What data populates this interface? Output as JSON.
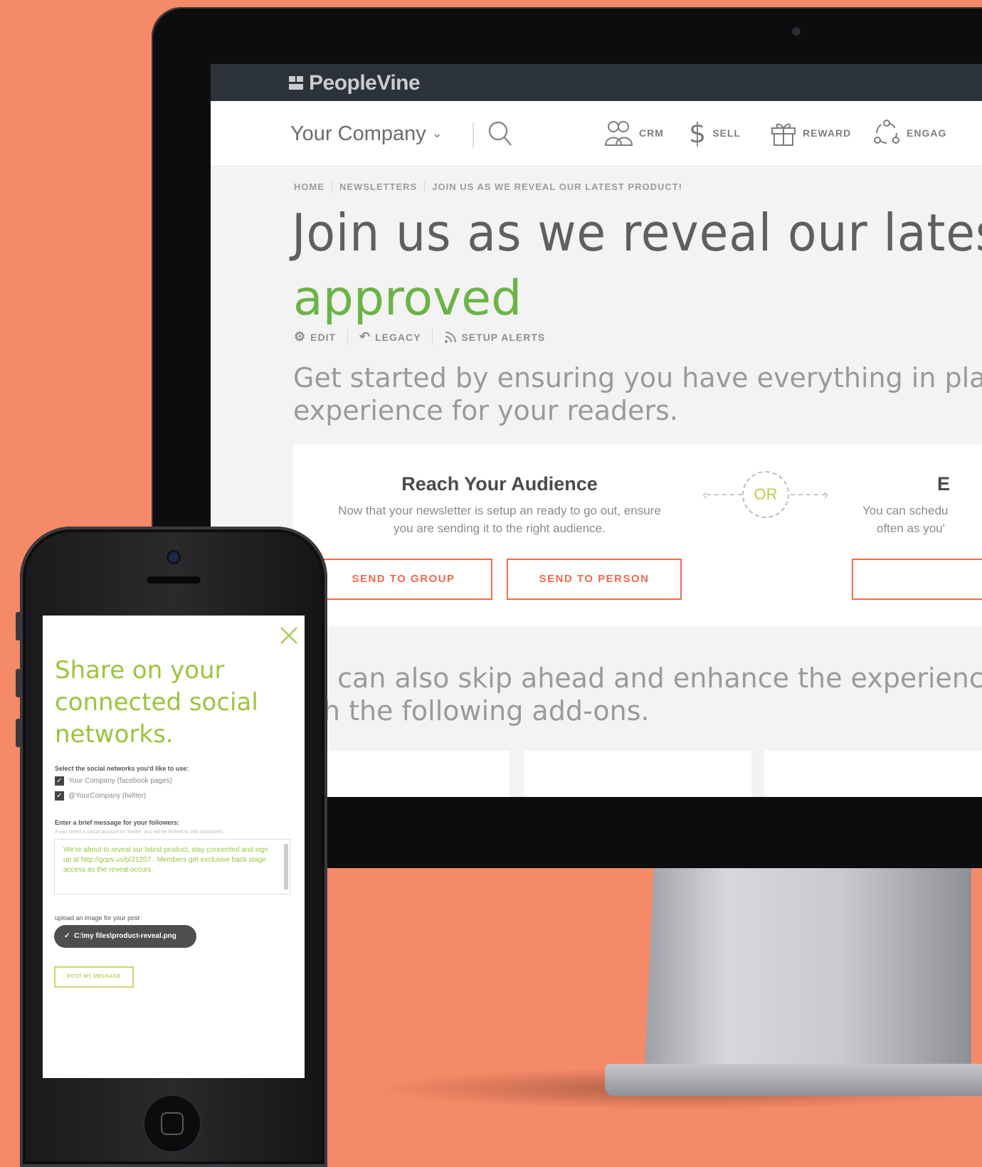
{
  "app": {
    "brand": "PeopleVine"
  },
  "navbar": {
    "company": "Your Company",
    "items": [
      {
        "label": "CRM",
        "icon": "people-icon"
      },
      {
        "label": "SELL",
        "icon": "dollar-icon"
      },
      {
        "label": "REWARD",
        "icon": "gift-icon"
      },
      {
        "label": "ENGAG",
        "icon": "network-icon"
      }
    ]
  },
  "breadcrumb": [
    "HOME",
    "NEWSLETTERS",
    "JOIN US AS WE REVEAL OUR LATEST PRODUCT!"
  ],
  "page": {
    "title": "Join us as we reveal our lates",
    "status": "approved",
    "actions": [
      "EDIT",
      "LEGACY",
      "SETUP ALERTS"
    ],
    "intro_line1": "Get started by ensuring you have everything in place a",
    "intro_line2": "experience for your readers."
  },
  "audience_card": {
    "title": "Reach Your Audience",
    "desc_line1": "Now that your newsletter is setup an ready to go out, ensure",
    "desc_line2": "you are sending it to the right audience.",
    "send_group": "SEND TO GROUP",
    "send_person": "SEND TO PERSON",
    "or_label": "OR",
    "right_title": "E",
    "right_desc_line1": "You can schedu",
    "right_desc_line2": "often as you'"
  },
  "skip": {
    "line1": "u can also skip ahead and enhance the experience.",
    "line2": "th the following add-ons."
  },
  "phone": {
    "title_line1": "Share on your",
    "title_line2": "connected social",
    "title_line3": "networks.",
    "select_label": "Select the social networks you'd like to use:",
    "networks": [
      "Your Company (facebook pages)",
      "@YourCompany (twitter)"
    ],
    "message_label": "Enter a brief message for your followers:",
    "message_hint": "If you select a social account on Twitter, you will be limited to 160 characters.",
    "message_value": "We're about to reveal our latest product, stay connected and sign up at http://gopv.us/p/21207 . Members get exclusive back stage access as the reveal occurs.",
    "upload_label": "upload an image for your post",
    "file_name": "C:\\my files\\product-reveal.png",
    "post_button": "POST MY MESSAGE"
  },
  "colors": {
    "background": "#f58a68",
    "accent_green": "#6ab446",
    "accent_orange": "#f06a4d",
    "lime": "#9bc43d",
    "topbar": "#2b3238"
  }
}
